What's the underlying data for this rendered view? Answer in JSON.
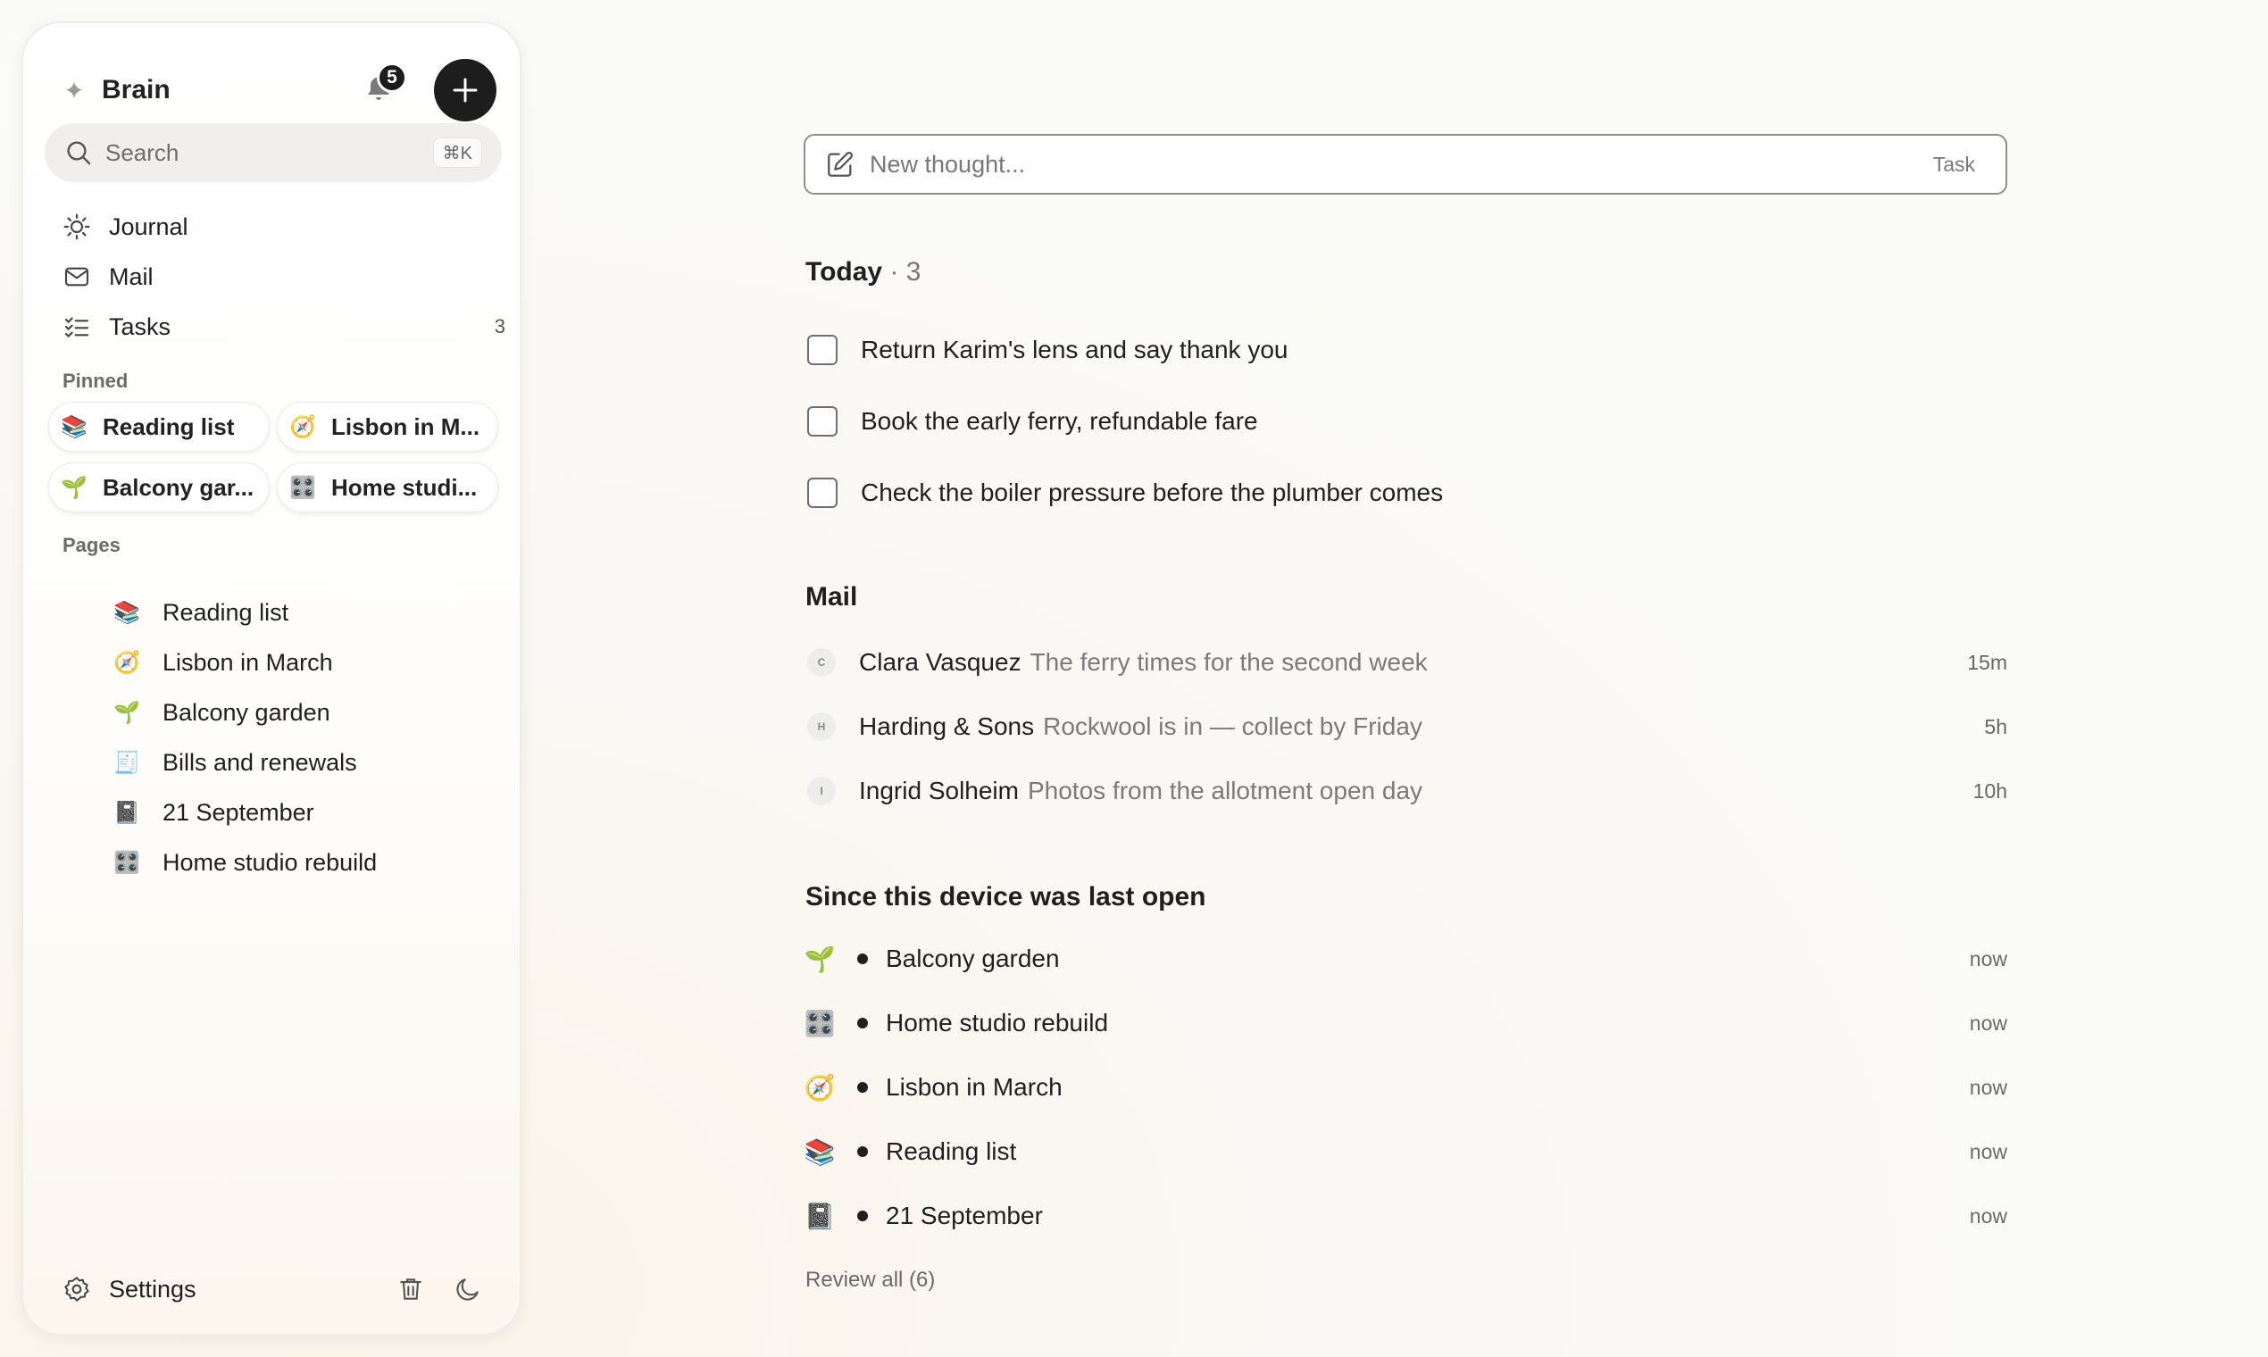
{
  "sidebar": {
    "brand": "Brain",
    "notifications_count": "5",
    "search": {
      "label": "Search",
      "shortcut": "⌘K"
    },
    "nav": [
      {
        "label": "Journal",
        "icon": "sun-icon"
      },
      {
        "label": "Mail",
        "icon": "mail-icon"
      },
      {
        "label": "Tasks",
        "icon": "checklist-icon",
        "count": "3"
      }
    ],
    "pinned_label": "Pinned",
    "pinned": [
      {
        "emoji": "📚",
        "label": "Reading list"
      },
      {
        "emoji": "🧭",
        "label": "Lisbon in M..."
      },
      {
        "emoji": "🌱",
        "label": "Balcony gar..."
      },
      {
        "emoji": "🎛️",
        "label": "Home studi..."
      }
    ],
    "pages_label": "Pages",
    "pages": [
      {
        "emoji": "📚",
        "label": "Reading list"
      },
      {
        "emoji": "🧭",
        "label": "Lisbon in March"
      },
      {
        "emoji": "🌱",
        "label": "Balcony garden"
      },
      {
        "emoji": "🧾",
        "label": "Bills and renewals"
      },
      {
        "emoji": "📓",
        "label": "21 September"
      },
      {
        "emoji": "🎛️",
        "label": "Home studio rebuild"
      }
    ],
    "settings_label": "Settings"
  },
  "compose": {
    "placeholder": "New thought...",
    "mode": "Task"
  },
  "today": {
    "title": "Today",
    "count": "· 3",
    "tasks": [
      "Return Karim's lens and say thank you",
      "Book the early ferry, refundable fare",
      "Check the boiler pressure before the plumber comes"
    ]
  },
  "mail": {
    "title": "Mail",
    "items": [
      {
        "initial": "C",
        "sender": "Clara Vasquez",
        "subject": "The ferry times for the second week",
        "time": "15m"
      },
      {
        "initial": "H",
        "sender": "Harding & Sons",
        "subject": "Rockwool is in — collect by Friday",
        "time": "5h"
      },
      {
        "initial": "I",
        "sender": "Ingrid Solheim",
        "subject": "Photos from the allotment open day",
        "time": "10h"
      }
    ]
  },
  "since": {
    "title": "Since this device was last open",
    "items": [
      {
        "emoji": "🌱",
        "label": "Balcony garden",
        "time": "now"
      },
      {
        "emoji": "🎛️",
        "label": "Home studio rebuild",
        "time": "now"
      },
      {
        "emoji": "🧭",
        "label": "Lisbon in March",
        "time": "now"
      },
      {
        "emoji": "📚",
        "label": "Reading list",
        "time": "now"
      },
      {
        "emoji": "📓",
        "label": "21 September",
        "time": "now"
      }
    ],
    "review_all": "Review all (6)"
  }
}
